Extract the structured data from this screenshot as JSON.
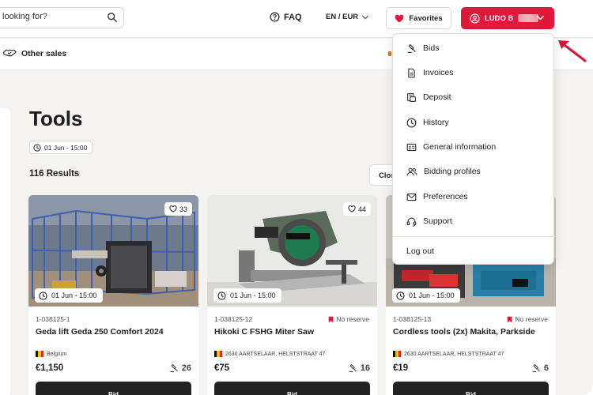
{
  "header": {
    "search_placeholder": "looking for?",
    "faq_label": "FAQ",
    "lang_label": "EN / EUR",
    "favorites_label": "Favorites",
    "user_label": "LUDO B"
  },
  "subnav": {
    "other_sales_label": "Other sales"
  },
  "page": {
    "title": "Tools",
    "date": "01 Jun - 15:00",
    "results": "116 Results",
    "close_label": "Close"
  },
  "cards": [
    {
      "likes": "33",
      "timer": "01 Jun - 15:00",
      "lot_id": "1-038125-1",
      "no_reserve": "",
      "title": "Geda lift Geda 250 Comfort 2024",
      "location": "Belgium",
      "price": "€1,150",
      "bids": "26",
      "bid_label": "Bid"
    },
    {
      "likes": "44",
      "timer": "01 Jun - 15:00",
      "lot_id": "1-038125-12",
      "no_reserve": "No reserve",
      "title": "Hikoki C FSHG Miter Saw",
      "location": "2630 AARTSELAAR, HELSTSTRAAT 47",
      "price": "€75",
      "bids": "16",
      "bid_label": "Bid"
    },
    {
      "likes": "",
      "timer": "01 Jun - 15:00",
      "lot_id": "1-038125-13",
      "no_reserve": "No reserve",
      "title": "Cordless tools (2x) Makita, Parkside",
      "location": "2630 AARTSELAAR, HELSTSTRAAT 47",
      "price": "€19",
      "bids": "6",
      "bid_label": "Bid"
    }
  ],
  "menu": {
    "items": [
      {
        "label": "Bids",
        "icon": "gavel-icon"
      },
      {
        "label": "Invoices",
        "icon": "document-icon"
      },
      {
        "label": "Deposit",
        "icon": "deposit-icon"
      },
      {
        "label": "History",
        "icon": "clock-icon"
      },
      {
        "label": "General information",
        "icon": "id-card-icon"
      },
      {
        "label": "Bidding profiles",
        "icon": "users-icon"
      },
      {
        "label": "Preferences",
        "icon": "envelope-icon"
      },
      {
        "label": "Support",
        "icon": "headset-icon"
      }
    ],
    "logout_label": "Log out"
  },
  "colors": {
    "brand_red": "#e2183b",
    "annotation_arrow": "#d8163a"
  }
}
